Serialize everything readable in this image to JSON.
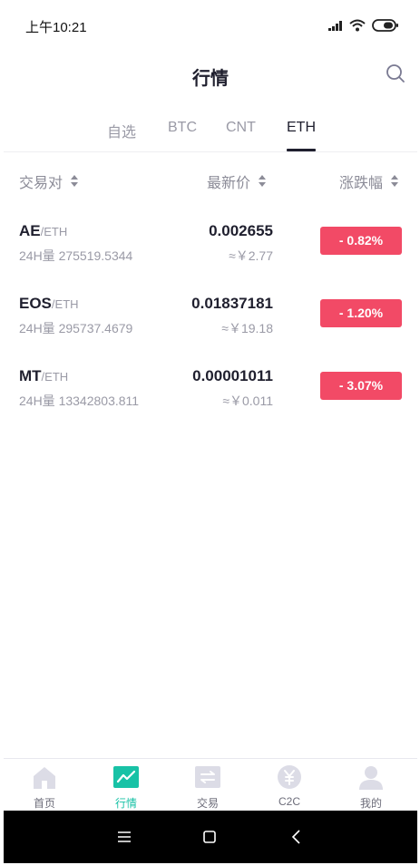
{
  "status_bar": {
    "time": "上午10:21"
  },
  "header": {
    "title": "行情"
  },
  "tabs": [
    {
      "label": "自选",
      "active": false
    },
    {
      "label": "BTC",
      "active": false
    },
    {
      "label": "CNT",
      "active": false
    },
    {
      "label": "ETH",
      "active": true
    }
  ],
  "columns": {
    "pair": "交易对",
    "price": "最新价",
    "change": "涨跌幅"
  },
  "rows": [
    {
      "base": "AE",
      "quote": "/ETH",
      "volume": "24H量 275519.5344",
      "price": "0.002655",
      "fiat": "≈￥2.77",
      "change": "- 0.82%"
    },
    {
      "base": "EOS",
      "quote": "/ETH",
      "volume": "24H量 295737.4679",
      "price": "0.01837181",
      "fiat": "≈￥19.18",
      "change": "- 1.20%"
    },
    {
      "base": "MT",
      "quote": "/ETH",
      "volume": "24H量 13342803.811",
      "price": "0.00001011",
      "fiat": "≈￥0.011",
      "change": "- 3.07%"
    }
  ],
  "bottom_nav": [
    {
      "label": "首页",
      "icon": "home-icon",
      "active": false
    },
    {
      "label": "行情",
      "icon": "chart-icon",
      "active": true
    },
    {
      "label": "交易",
      "icon": "exchange-icon",
      "active": false
    },
    {
      "label": "C2C",
      "icon": "yen-icon",
      "active": false
    },
    {
      "label": "我的",
      "icon": "user-icon",
      "active": false
    }
  ],
  "colors": {
    "accent": "#18c2a6",
    "down": "#f24a66",
    "text": "#1f1f2e",
    "muted": "#9a9aa6"
  }
}
